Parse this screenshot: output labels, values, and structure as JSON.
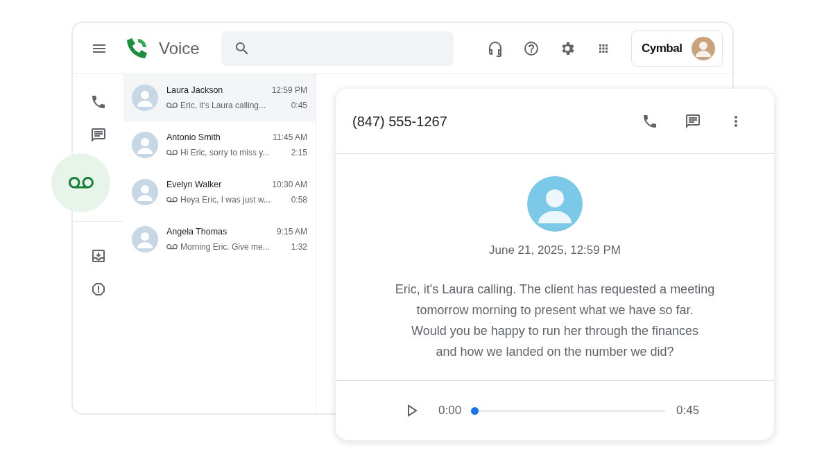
{
  "app": {
    "title": "Voice",
    "account": {
      "brand": "Cymbal"
    }
  },
  "rail": [
    {
      "kind": "calls",
      "selected": false
    },
    {
      "kind": "messages",
      "selected": false
    },
    {
      "kind": "voicemail",
      "selected": true
    },
    {
      "kind": "divider"
    },
    {
      "kind": "archive",
      "selected": false
    },
    {
      "kind": "spam",
      "selected": false
    }
  ],
  "conversations": [
    {
      "name": "Laura Jackson",
      "time": "12:59 PM",
      "preview": "Eric, it's Laura calling...",
      "duration": "0:45",
      "selected": true
    },
    {
      "name": "Antonio Smith",
      "time": "11:45 AM",
      "preview": "Hi Eric, sorry to miss y...",
      "duration": "2:15",
      "selected": false
    },
    {
      "name": "Evelyn Walker",
      "time": "10:30 AM",
      "preview": "Heya Eric, I was just w...",
      "duration": "0:58",
      "selected": false
    },
    {
      "name": "Angela Thomas",
      "time": "9:15 AM",
      "preview": "Morning Eric. Give me...",
      "duration": "1:32",
      "selected": false
    }
  ],
  "detail": {
    "phone": "(847) 555-1267",
    "date": "June 21, 2025, 12:59 PM",
    "transcript": "Eric, it's Laura calling. The client has requested a meeting\ntomorrow morning to present what we have so far.\nWould you be happy to run her through the finances\nand how we landed on the number we did?",
    "player": {
      "current": "0:00",
      "total": "0:45",
      "level": 0
    }
  }
}
